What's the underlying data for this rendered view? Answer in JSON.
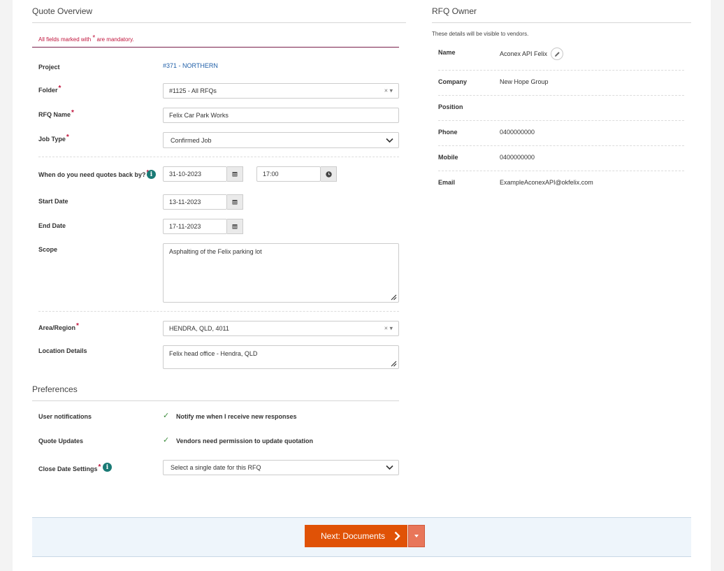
{
  "quote_overview": {
    "title": "Quote Overview",
    "mandatory_prefix": "All fields marked with",
    "mandatory_star": "*",
    "mandatory_suffix": "are mandatory.",
    "project": {
      "label": "Project",
      "value": "#371 - NORTHERN"
    },
    "folder": {
      "label": "Folder",
      "value": "#1125 - All RFQs",
      "clear": "×"
    },
    "rfq_name": {
      "label": "RFQ Name",
      "value": "Felix Car Park Works"
    },
    "job_type": {
      "label": "Job Type",
      "value": "Confirmed Job"
    },
    "quotes_back_by": {
      "label": "When do you need quotes back by?",
      "date": "31-10-2023",
      "time": "17:00"
    },
    "start_date": {
      "label": "Start Date",
      "value": "13-11-2023"
    },
    "end_date": {
      "label": "End Date",
      "value": "17-11-2023"
    },
    "scope": {
      "label": "Scope",
      "value": "Asphalting of the Felix parking lot"
    },
    "area_region": {
      "label": "Area/Region",
      "value": "HENDRA, QLD, 4011",
      "clear": "×"
    },
    "location_details": {
      "label": "Location Details",
      "value": "Felix head office - Hendra, QLD"
    },
    "required_mark": "*"
  },
  "preferences": {
    "title": "Preferences",
    "user_notifications": {
      "label": "User notifications",
      "option": "Notify me when I receive new responses",
      "checked": true
    },
    "quote_updates": {
      "label": "Quote Updates",
      "option": "Vendors need permission to update quotation",
      "checked": true
    },
    "close_date": {
      "label": "Close Date Settings",
      "value": "Select a single date for this RFQ"
    }
  },
  "rfq_owner": {
    "title": "RFQ Owner",
    "note": "These details will be visible to vendors.",
    "rows": [
      {
        "label": "Name",
        "value": "Aconex API Felix"
      },
      {
        "label": "Company",
        "value": "New Hope Group"
      },
      {
        "label": "Position",
        "value": ""
      },
      {
        "label": "Phone",
        "value": "0400000000"
      },
      {
        "label": "Mobile",
        "value": "0400000000"
      },
      {
        "label": "Email",
        "value": "ExampleAconexAPI@okfelix.com"
      }
    ]
  },
  "footer": {
    "next_label": "Next: Documents"
  },
  "colors": {
    "accent": "#e05206",
    "info": "#1a7a75",
    "required": "#c0143c",
    "link": "#1f5fa8"
  }
}
